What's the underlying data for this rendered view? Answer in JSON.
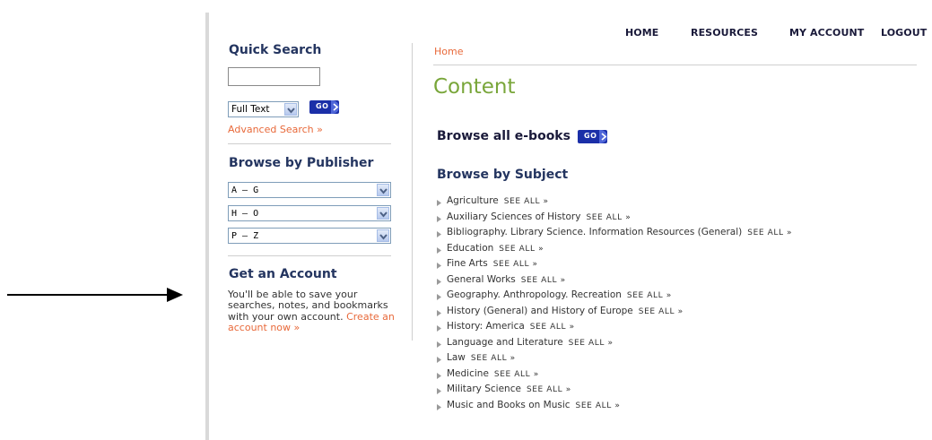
{
  "nav": {
    "home": "HOME",
    "resources": "RESOURCES",
    "my_account": "MY ACCOUNT",
    "logout": "LOGOUT"
  },
  "sidebar": {
    "quick_search": {
      "heading": "Quick Search",
      "input_value": "",
      "type_selected": "Full Text",
      "go_label": "GO",
      "advanced_link": "Advanced Search »"
    },
    "browse_publisher": {
      "heading": "Browse by Publisher",
      "selects": [
        "A – G",
        "H – O",
        "P – Z"
      ]
    },
    "account": {
      "heading": "Get an Account",
      "text": "You'll be able to save your searches, notes, and bookmarks with your own account.",
      "link": "Create an account now »"
    }
  },
  "main": {
    "breadcrumb": "Home",
    "title": "Content",
    "browse_all": {
      "label": "Browse all e-books",
      "go_label": "GO"
    },
    "browse_subject": {
      "heading": "Browse by Subject",
      "see_all_label": "SEE ALL »",
      "subjects": [
        "Agriculture",
        "Auxiliary Sciences of History",
        "Bibliography. Library Science. Information Resources (General)",
        "Education",
        "Fine Arts",
        "General Works",
        "Geography. Anthropology. Recreation",
        "History (General) and History of Europe",
        "History: America",
        "Language and Literature",
        "Law",
        "Medicine",
        "Military Science",
        "Music and Books on Music"
      ]
    }
  },
  "colors": {
    "heading_navy": "#243560",
    "title_green": "#79a63a",
    "link_orange": "#e8693a",
    "go_blue": "#1b2fa8"
  }
}
